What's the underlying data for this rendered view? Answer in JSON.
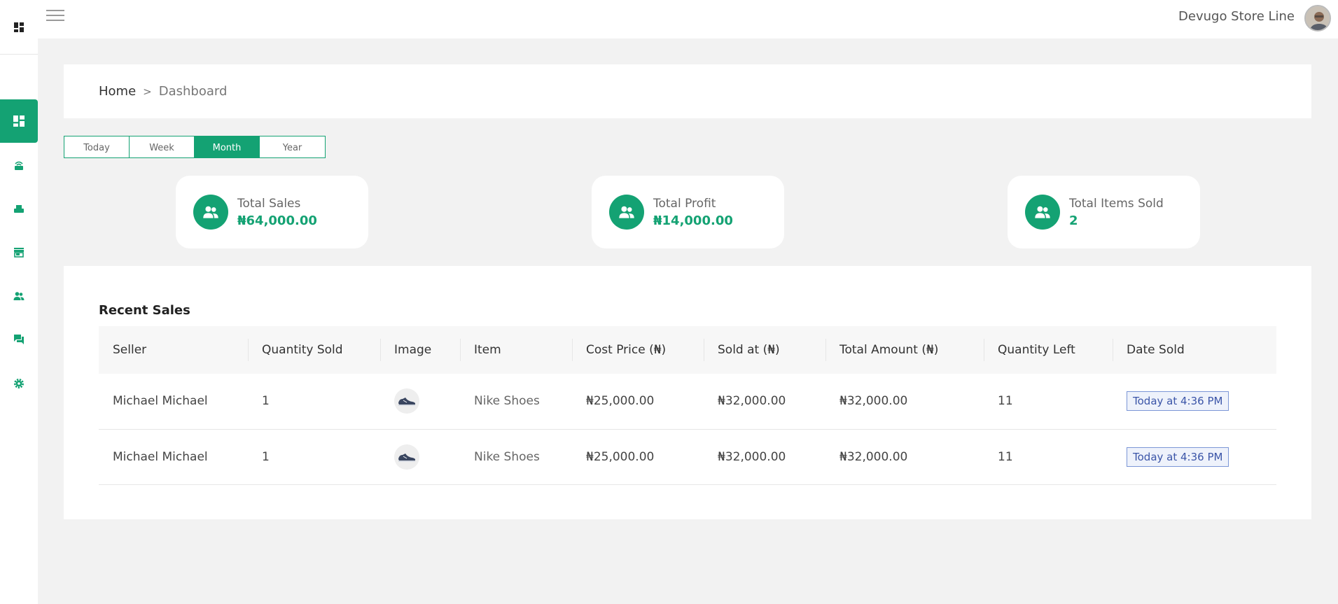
{
  "topbar": {
    "store_name": "Devugo Store Line"
  },
  "breadcrumb": {
    "home": "Home",
    "separator": ">",
    "current": "Dashboard"
  },
  "periods": [
    "Today",
    "Week",
    "Month",
    "Year"
  ],
  "active_period": "Month",
  "stats": [
    {
      "label": "Total Sales",
      "value": "₦64,000.00"
    },
    {
      "label": "Total Profit",
      "value": "₦14,000.00"
    },
    {
      "label": "Total Items Sold",
      "value": "2"
    }
  ],
  "recent_sales": {
    "title": "Recent Sales",
    "columns": [
      "Seller",
      "Quantity Sold",
      "Image",
      "Item",
      "Cost Price (₦)",
      "Sold at (₦)",
      "Total Amount (₦)",
      "Quantity Left",
      "Date Sold"
    ],
    "rows": [
      {
        "seller": "Michael Michael",
        "quantity_sold": "1",
        "item": "Nike Shoes",
        "cost_price": "₦25,000.00",
        "sold_at": "₦32,000.00",
        "total_amount": "₦32,000.00",
        "quantity_left": "11",
        "date_sold": "Today at 4:36 PM"
      },
      {
        "seller": "Michael Michael",
        "quantity_sold": "1",
        "item": "Nike Shoes",
        "cost_price": "₦25,000.00",
        "sold_at": "₦32,000.00",
        "total_amount": "₦32,000.00",
        "quantity_left": "11",
        "date_sold": "Today at 4:36 PM"
      }
    ]
  },
  "colors": {
    "accent": "#14a273",
    "badge_border": "#7b96d6",
    "badge_text": "#3b55a8"
  },
  "sidebar_icons": [
    "dashboard-icon",
    "router-icon",
    "inventory-icon",
    "store-icon",
    "users-icon",
    "chat-icon",
    "gear-icon"
  ]
}
